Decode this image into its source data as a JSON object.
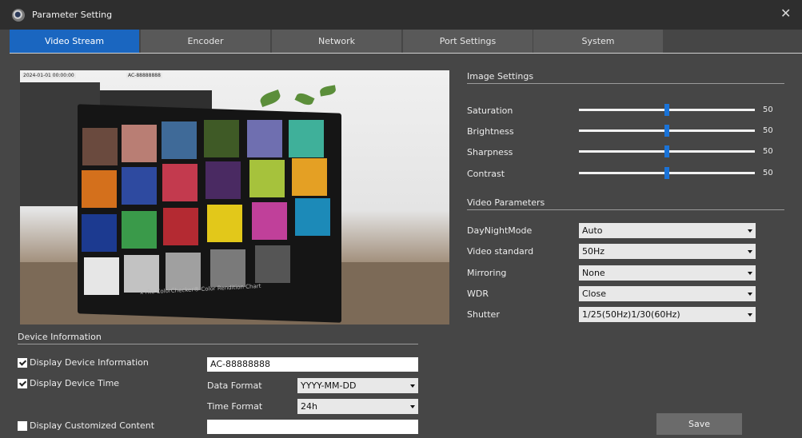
{
  "window": {
    "title": "Parameter Setting",
    "icon": "camera-lens-icon"
  },
  "tabs": [
    {
      "label": "Video Stream",
      "active": true
    },
    {
      "label": "Encoder",
      "active": false
    },
    {
      "label": "Network",
      "active": false
    },
    {
      "label": "Port Settings",
      "active": false
    },
    {
      "label": "System",
      "active": false
    }
  ],
  "preview": {
    "overlay_time": "2024-01-01 00:00:00",
    "overlay_id": "AC-88888888",
    "chart_brand": "x·rite ColorChecker® Color Rendition Chart"
  },
  "image_settings": {
    "title": "Image Settings",
    "sliders": [
      {
        "label": "Saturation",
        "value": 50,
        "max": 100
      },
      {
        "label": "Brightness",
        "value": 50,
        "max": 100
      },
      {
        "label": "Sharpness",
        "value": 50,
        "max": 100
      },
      {
        "label": "Contrast",
        "value": 50,
        "max": 100
      }
    ]
  },
  "video_parameters": {
    "title": "Video Parameters",
    "fields": [
      {
        "label": "DayNightMode",
        "value": "Auto"
      },
      {
        "label": "Video standard",
        "value": "50Hz"
      },
      {
        "label": "Mirroring",
        "value": "None"
      },
      {
        "label": "WDR",
        "value": "Close"
      },
      {
        "label": "Shutter",
        "value": "1/25(50Hz)1/30(60Hz)"
      }
    ]
  },
  "device_info": {
    "title": "Device Information",
    "display_device_info": {
      "label": "Display Device Information",
      "checked": true,
      "value": "AC-88888888"
    },
    "display_device_time": {
      "label": "Display Device Time",
      "checked": true
    },
    "data_format": {
      "label": "Data Format",
      "value": "YYYY-MM-DD"
    },
    "time_format": {
      "label": "Time Format",
      "value": "24h"
    },
    "display_custom": {
      "label": "Display Customized Content",
      "checked": false,
      "value": ""
    }
  },
  "actions": {
    "save_label": "Save"
  },
  "colors": {
    "accent": "#1a66c0",
    "slider_thumb": "#1a73d8",
    "background": "#464646",
    "titlebar": "#2e2e2e"
  }
}
